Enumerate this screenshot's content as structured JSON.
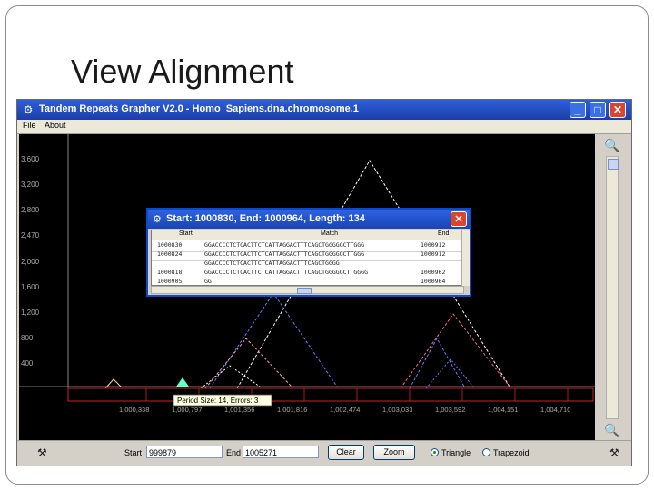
{
  "slide": {
    "title": "View Alignment"
  },
  "window": {
    "title": "Tandem Repeats Grapher V2.0 - Homo_Sapiens.dna.chromosome.1",
    "minimize": "_",
    "maximize": "□",
    "close": "✕"
  },
  "menu": {
    "items": [
      "File",
      "About"
    ]
  },
  "graph": {
    "y_ticks": [
      "3,600",
      "3,200",
      "2,800",
      "2,470",
      "2,000",
      "1,600",
      "1,200",
      "800",
      "400"
    ],
    "x_ticks": [
      "1,000,338",
      "1,000,797",
      "1,001,356",
      "1,001,816",
      "1,002,474",
      "1,003,033",
      "1,003,592",
      "1,004,151",
      "1,004,710"
    ],
    "tooltip": "Period Size: 14, Errors: 3",
    "line_colors": {
      "white": "#ffffff",
      "blue": "#6a7bff",
      "pink": "#ff6a8a",
      "red": "#cc2222",
      "green": "#66ffcc"
    }
  },
  "dialog": {
    "title": "Start: 1000830, End: 1000964, Length: 134",
    "close": "✕",
    "columns": [
      "Start",
      "Match",
      "End"
    ],
    "rows": [
      [
        "1000830",
        "GGACCCCTCTCACTTCTCATTAGGACTTTCAGCTGGGGGCTTGGG",
        "1000912"
      ],
      [
        "1000824",
        "GGACCCCTCTCACTTCTCATTAGGACTTTCAGCTGGGGGCTTGGG",
        "1000912"
      ],
      [
        "",
        "GGACCCCTCTCACTTCTCATTAGGACTTTCAGCTGGGG",
        ""
      ],
      [
        "1000818",
        "GGACCCCTCTCACTTCTCATTAGGACTTTCAGCTGGGGGCTTGGGG",
        "1000962"
      ],
      [
        "1000905",
        "GG",
        "1000964"
      ]
    ]
  },
  "bottom": {
    "start_label": "Start",
    "start_value": "999879",
    "end_label": "End",
    "end_value": "1005271",
    "clear": "Clear",
    "zoom": "Zoom",
    "triangle": "Triangle",
    "trapezoid": "Trapezoid"
  }
}
